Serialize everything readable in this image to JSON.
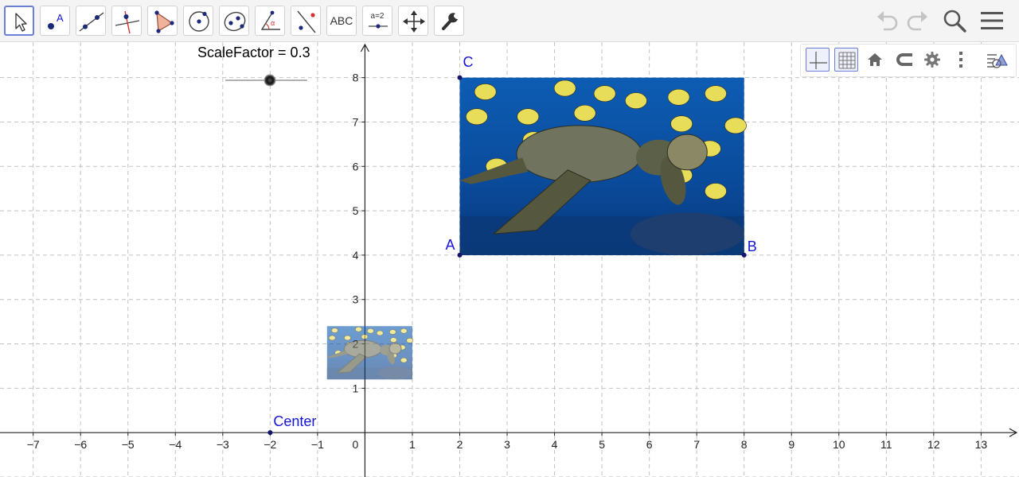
{
  "toolbar": {
    "tools": [
      {
        "name": "move-tool",
        "icon": "arrow-pointer-icon"
      },
      {
        "name": "point-tool",
        "icon": "point-icon"
      },
      {
        "name": "line-tool",
        "icon": "line-icon"
      },
      {
        "name": "perpendicular-line-tool",
        "icon": "perpendicular-line-icon"
      },
      {
        "name": "polygon-tool",
        "icon": "polygon-icon"
      },
      {
        "name": "circle-tool",
        "icon": "circle-icon"
      },
      {
        "name": "ellipse-tool",
        "icon": "ellipse-icon"
      },
      {
        "name": "angle-tool",
        "icon": "angle-icon"
      },
      {
        "name": "reflect-tool",
        "icon": "reflect-icon"
      },
      {
        "name": "text-tool",
        "icon": "text-icon",
        "label": "ABC"
      },
      {
        "name": "slider-tool",
        "icon": "slider-icon",
        "label": "a=2"
      },
      {
        "name": "move-view-tool",
        "icon": "move-arrows-icon"
      },
      {
        "name": "tools-customize",
        "icon": "wrench-icon"
      }
    ],
    "active_tool": "move-tool",
    "right_buttons": [
      "undo-icon",
      "redo-icon",
      "search-icon",
      "menu-icon"
    ]
  },
  "style_bar": {
    "buttons": [
      "axes-icon",
      "grid-icon",
      "home-icon",
      "magnet-icon",
      "settings-icon",
      "more-vertical-icon",
      "algebra-toggle-icon"
    ]
  },
  "slider": {
    "caption": "ScaleFactor = 0.3",
    "name": "ScaleFactor",
    "value": 0.3
  },
  "axes": {
    "x_ticks": [
      "−7",
      "−6",
      "−5",
      "−4",
      "−3",
      "−2",
      "−1",
      "0",
      "1",
      "2",
      "3",
      "4",
      "5",
      "6",
      "7",
      "8",
      "9",
      "10",
      "11",
      "12",
      "13"
    ],
    "y_ticks": [
      "1",
      "2",
      "3",
      "4",
      "5",
      "6",
      "7",
      "8"
    ],
    "x_range": [
      -7.7,
      13.8
    ],
    "y_range": [
      -1.0,
      8.8
    ]
  },
  "points": {
    "A": {
      "label": "A",
      "x": 2,
      "y": 4
    },
    "B": {
      "label": "B",
      "x": 8,
      "y": 4
    },
    "C": {
      "label": "C",
      "x": 2,
      "y": 8
    },
    "Center": {
      "label": "Center",
      "x": -2,
      "y": 0
    }
  },
  "colors": {
    "point": "#1515d8",
    "point_fill": "#14146e",
    "toolbar_bg": "#f4f4f4",
    "active_border": "#6b7fd8",
    "grid": "#c2c2c2"
  }
}
